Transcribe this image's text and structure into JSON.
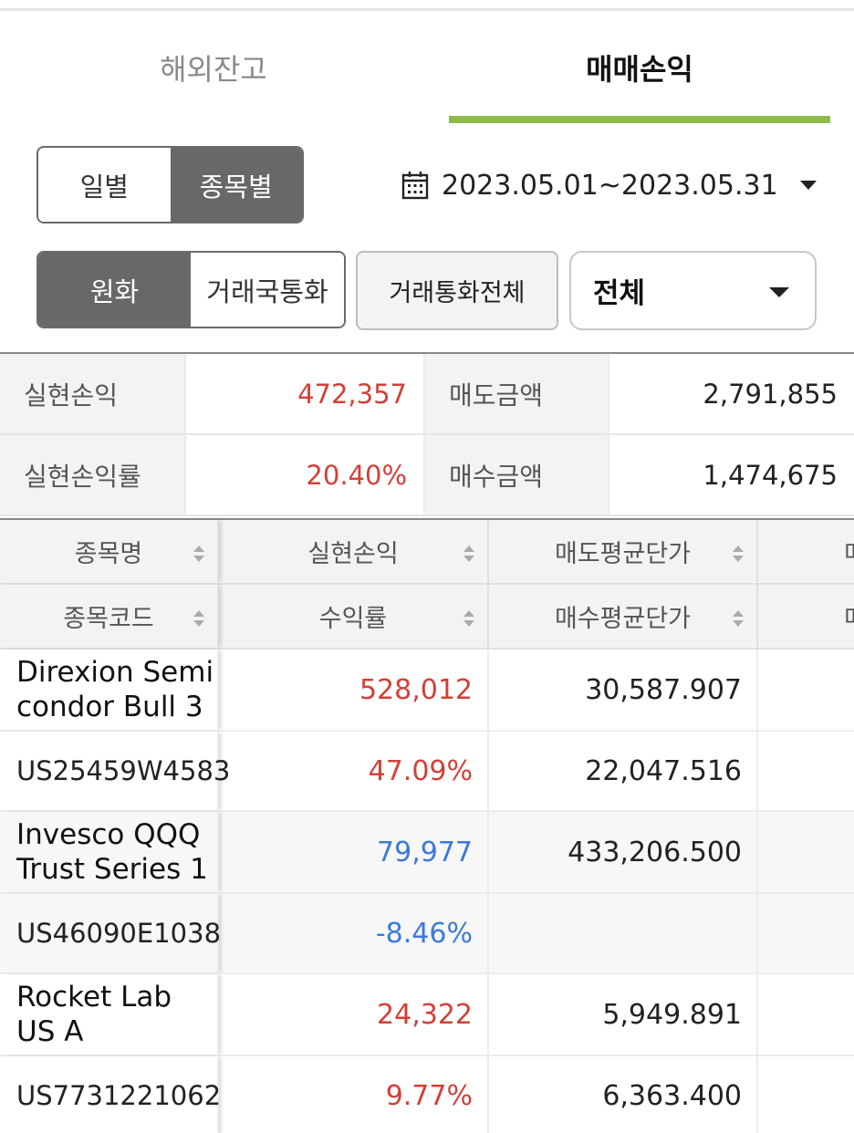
{
  "tabs": [
    {
      "label": "해외잔고",
      "active": false
    },
    {
      "label": "매매손익",
      "active": true
    }
  ],
  "view_toggle": {
    "daily": "일별",
    "by_stock": "종목별",
    "selected": "종목별"
  },
  "date_range": {
    "value": "2023.05.01~2023.05.31",
    "icon": "calendar-icon"
  },
  "currency_toggle": {
    "won": "원화",
    "trade_currency": "거래국통화",
    "selected": "원화"
  },
  "all_currency_button": "거래통화전체",
  "filter_select": {
    "value": "전체"
  },
  "summary": {
    "realized_pl_label": "실현손익",
    "realized_pl_value": "472,357",
    "sell_amount_label": "매도금액",
    "sell_amount_value": "2,791,855",
    "realized_rate_label": "실현손익률",
    "realized_rate_value": "20.40%",
    "buy_amount_label": "매수금액",
    "buy_amount_value": "1,474,675"
  },
  "colors": {
    "positive": "#d43f38",
    "negative": "#3b7ad9",
    "tab_accent": "#8dba4c",
    "toggle_on": "#686868"
  },
  "grid": {
    "header_row1": [
      "종목명",
      "실현손익",
      "매도평균단가",
      "매"
    ],
    "header_row2": [
      "종목코드",
      "수익률",
      "매수평균단가",
      "매"
    ],
    "rows": [
      {
        "name": "Direxion Semi condor Bull 3",
        "code": "US25459W4583",
        "pl": "528,012",
        "rate": "47.09%",
        "sell_avg": "30,587.907",
        "buy_avg": "22,047.516"
      },
      {
        "name": "Invesco QQQ Trust Series 1",
        "code": "US46090E1038",
        "pl": "79,977",
        "rate": "-8.46%",
        "sell_avg": "433,206.500",
        "buy_avg": ""
      },
      {
        "name": "Rocket Lab US A",
        "code": "US7731221062",
        "pl": "24,322",
        "rate": "9.77%",
        "sell_avg": "5,949.891",
        "buy_avg": "6,363.400"
      }
    ]
  }
}
